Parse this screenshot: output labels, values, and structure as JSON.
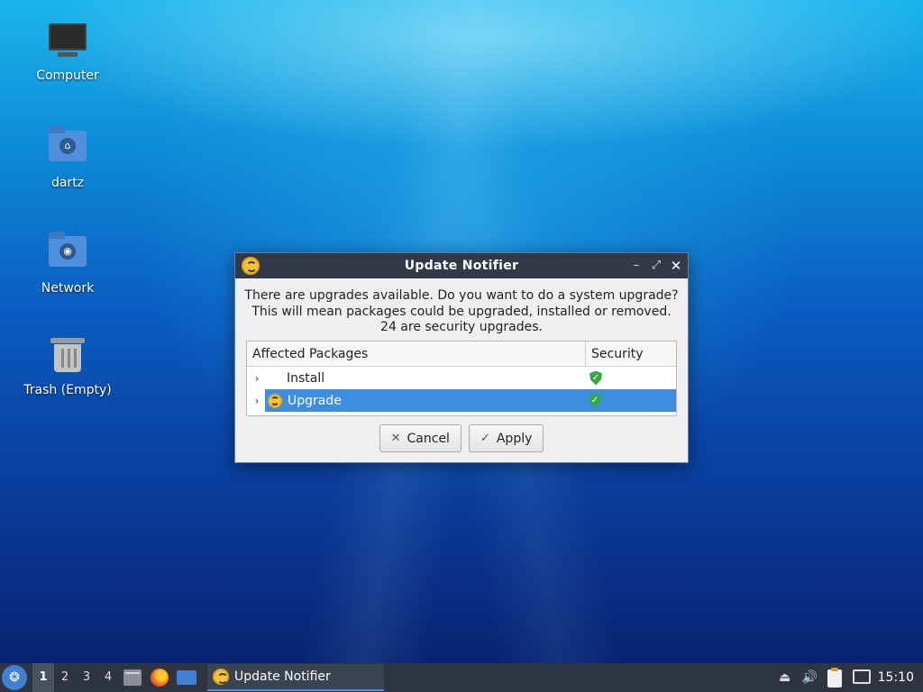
{
  "desktop": {
    "icons": [
      {
        "label": "Computer",
        "icon": "computer-icon"
      },
      {
        "label": "dartz",
        "icon": "home-folder-icon"
      },
      {
        "label": "Network",
        "icon": "network-folder-icon"
      },
      {
        "label": "Trash (Empty)",
        "icon": "trash-icon"
      }
    ]
  },
  "dialog": {
    "title": "Update Notifier",
    "message_lines": [
      "There are upgrades available. Do you want to do a system upgrade?",
      "This will mean packages could be upgraded, installed or removed.",
      "24 are security upgrades."
    ],
    "columns": [
      "Affected Packages",
      "Security"
    ],
    "rows": [
      {
        "label": "Install",
        "icon": "install-icon",
        "selected": false,
        "security": "shield-check-icon"
      },
      {
        "label": "Upgrade",
        "icon": "upgrade-icon",
        "selected": true,
        "security": "shield-check-icon"
      }
    ],
    "buttons": {
      "cancel": "Cancel",
      "apply": "Apply"
    },
    "colors": {
      "titlebar": "#323a47",
      "selection": "#3d8ee0",
      "shield": "#3aa543"
    }
  },
  "taskbar": {
    "workspaces": [
      "1",
      "2",
      "3",
      "4"
    ],
    "active_workspace": "1",
    "task_label": "Update Notifier",
    "clock": "15:10"
  }
}
